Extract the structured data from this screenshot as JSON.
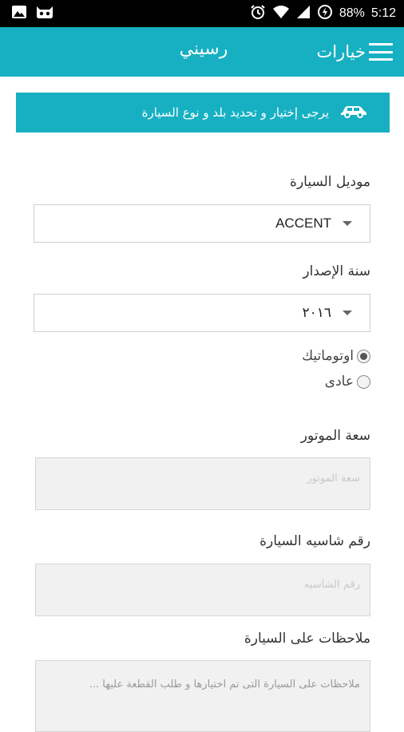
{
  "status_bar": {
    "battery": "88%",
    "time": "5:12"
  },
  "app_bar": {
    "menu_label": "خيارات",
    "title": "رسيني"
  },
  "notice": {
    "text": "يرجى إختيار و تحديد بلد و نوع السيارة"
  },
  "form": {
    "model": {
      "label": "موديل السيارة",
      "value": "ACCENT"
    },
    "year": {
      "label": "سنة الإصدار",
      "value": "٢٠١٦"
    },
    "transmission": {
      "options": [
        {
          "label": "اوتوماتيك",
          "selected": true
        },
        {
          "label": "عادى",
          "selected": false
        }
      ]
    },
    "engine": {
      "label": "سعة الموتور",
      "placeholder": "سعة الموتور"
    },
    "chassis": {
      "label": "رقم شاسيه السيارة",
      "placeholder": "رقم الشاسيه"
    },
    "notes": {
      "label": "ملاحظات على السيارة",
      "placeholder": "ملاحظات على السيارة التى تم اختيارها و طلب القطعة عليها ..."
    }
  },
  "colors": {
    "accent": "#17b0c2",
    "status_bar": "#000000"
  }
}
